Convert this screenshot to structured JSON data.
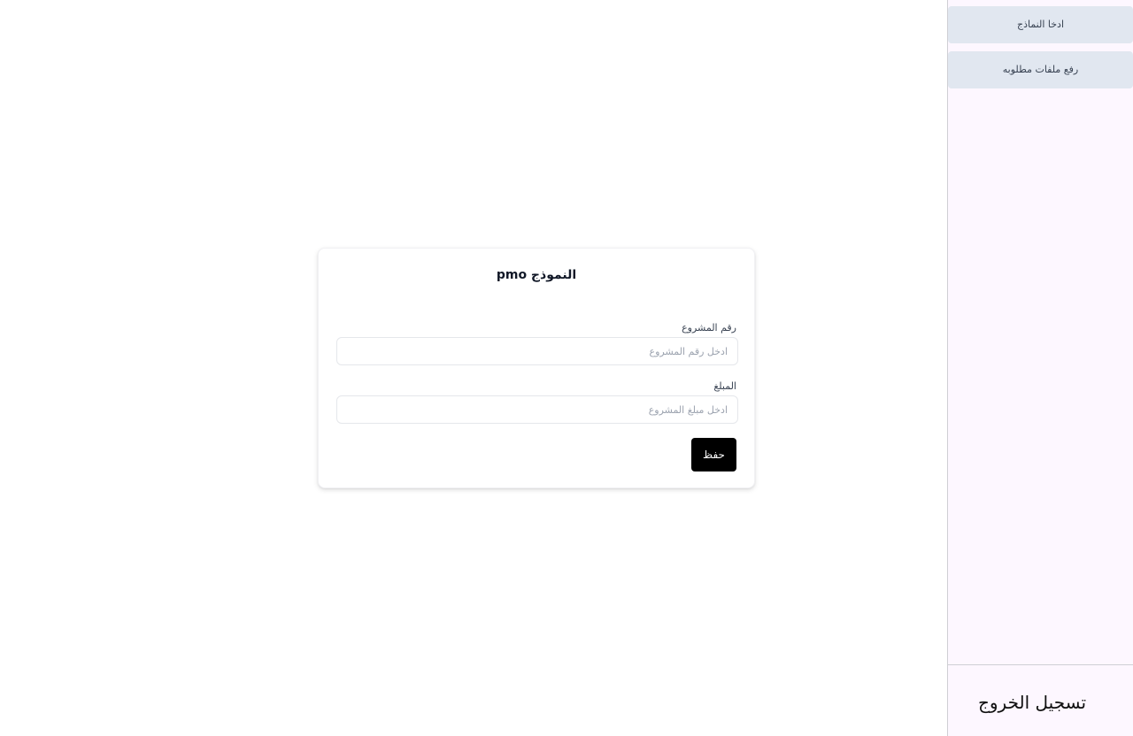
{
  "form": {
    "title": "النموذج pmo",
    "project_number_label": "رقم المشروع",
    "project_number_placeholder": "ادخل رقم المشروع",
    "project_number_value": "",
    "amount_label": "المبلغ",
    "amount_placeholder": "ادخل مبلغ المشروع",
    "amount_value": "",
    "save_label": "حفظ"
  },
  "sidebar": {
    "items": [
      {
        "label": "ادخا النماذج"
      },
      {
        "label": "رفع ملفات مطلوبه"
      }
    ],
    "logout_label": "تسجيل الخروج"
  },
  "colors": {
    "sidebar_bg": "#fdf7ff",
    "nav_item_bg": "#e1e7f0",
    "primary_button": "#000000"
  }
}
